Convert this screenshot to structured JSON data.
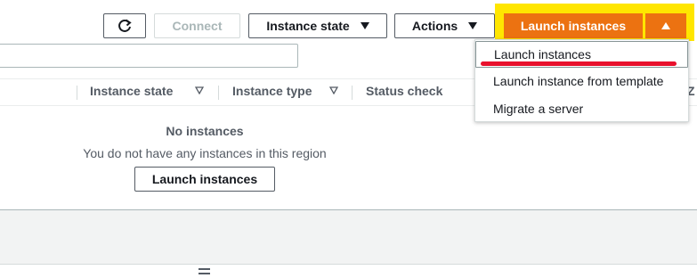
{
  "toolbar": {
    "refresh_icon": "refresh-icon",
    "connect_label": "Connect",
    "instance_state_label": "Instance state",
    "actions_label": "Actions",
    "launch_instances_label": "Launch instances"
  },
  "search": {
    "placeholder": ""
  },
  "table": {
    "columns": [
      {
        "label": "Instance state"
      },
      {
        "label": "Instance type"
      },
      {
        "label": "Status check"
      },
      {
        "label": "Z"
      }
    ]
  },
  "empty_state": {
    "title": "No instances",
    "subtitle": "You do not have any instances in this region",
    "button_label": "Launch instances"
  },
  "launch_menu": {
    "items": [
      {
        "label": "Launch instances"
      },
      {
        "label": "Launch instance from template"
      },
      {
        "label": "Migrate a server"
      }
    ]
  },
  "colors": {
    "accent": "#ec7211",
    "highlight": "#ffe600",
    "annotation": "#e8112d"
  }
}
